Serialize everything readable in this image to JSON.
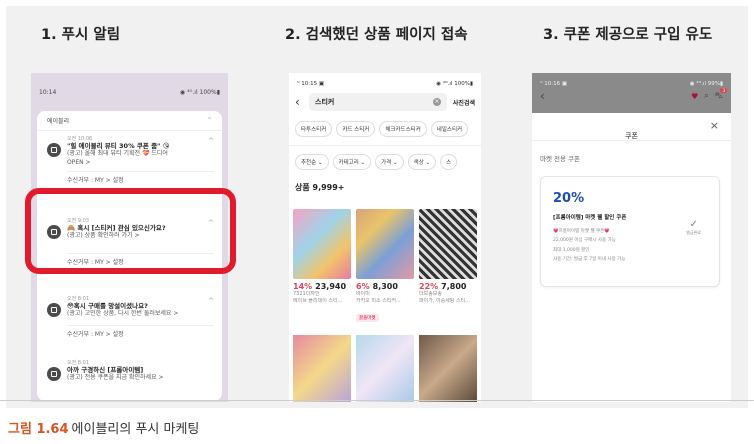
{
  "headings": {
    "step1": "1. 푸시 알림",
    "step2": "2. 검색했던 상품 페이지 접속",
    "step3": "3. 쿠폰 제공으로 구입 유도"
  },
  "caption": {
    "num": "그림 1.64",
    "text": "에이블리의 푸시 마케팅"
  },
  "p1": {
    "status": {
      "time": "10:14",
      "icons": "◉ ⁴ᴳ.ıl 100%▮"
    },
    "app": "에이블리",
    "notifs": [
      {
        "time": "오전 10:06",
        "title": "\"힐 에이블리 뷰티 30% 쿠폰 줌\" 😘",
        "desc1": "(광고) 올해 최대 뷰티 기획전 💝 드디어",
        "desc2": "OPEN >",
        "sub": "수신거부 : MY > 설정"
      },
      {
        "time": "오전 9:03",
        "title": "🙈 혹시 [스티커] 관심 있으신가요?",
        "desc1": "(광고) 상품 확인하러 가기 >",
        "desc2": "",
        "sub": "수신거부 : MY > 설정"
      },
      {
        "time": "오전 8:01",
        "title": "😳혹시 구매를 망설이셨나요?",
        "desc1": "(광고) 고민한 상품, 다시 한번 둘러보세요 >",
        "desc2": "",
        "sub": "수신거부 : MY > 설정"
      },
      {
        "time": "오전 8:01",
        "title": "아까 구경하신 [프롬아이템]",
        "desc1": "(광고) 전용 쿠폰을 지금 확인하세요 >",
        "desc2": "",
        "sub": ""
      }
    ]
  },
  "p2": {
    "status": {
      "time": "ᵁ 10:15 ▣",
      "icons": "◉ ⁴ᴳ.ıl 100%▮"
    },
    "search": "스티커",
    "photo_search": "사진검색",
    "chips": [
      "타투스티커",
      "카드 스티커",
      "체크카드스티커",
      "네일스티커"
    ],
    "filters": [
      "추천순 ⌄",
      "카테고리 ⌄",
      "가격 ⌄",
      "색상 ⌄",
      "스"
    ],
    "count_label": "상품 9,999+",
    "products": [
      {
        "pct": "14%",
        "price": "23,940",
        "shop": "7321디자인",
        "desc": "에이브 플리데이 스티...",
        "badge": ""
      },
      {
        "pct": "6%",
        "price": "8,300",
        "shop": "바이미",
        "desc": "카카오 미소 스티커...",
        "badge": "꿀플마켓"
      },
      {
        "pct": "22%",
        "price": "7,800",
        "shop": "더보송보송",
        "desc": "파이가, 이중세팅 스티...",
        "badge": ""
      }
    ]
  },
  "p3": {
    "status": {
      "time": "ᵁ 10:16 ▣",
      "icons": "◉ ⁴ᴳ.ıl 99%▮"
    },
    "sheet_title": "쿠폰",
    "section_title": "마켓 전용 쿠폰",
    "coupon": {
      "pct": "20%",
      "name": "[프롬아이템] 마켓 웰 할인 쿠폰",
      "line1": "💗프롬아이템 마켓 웰 쿠폰💗",
      "line2": "22,000원 이상 구매시 사용 가능",
      "line3": "최대 1,000원 할인",
      "line4": "사용 기간: 발급 후 7일 이내 사용 가능",
      "status": "발급완료"
    },
    "cart_count": "3"
  }
}
